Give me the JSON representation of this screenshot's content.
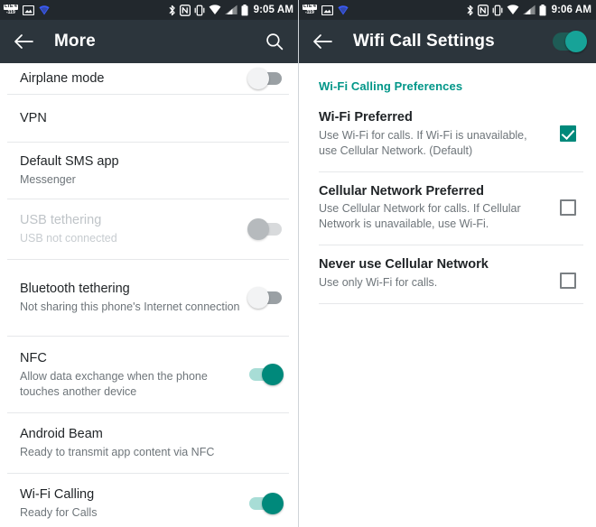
{
  "left": {
    "statusbar": {
      "lte_label": "LTE 4",
      "lte_value": "-119",
      "icons": [
        "image-icon",
        "blue-wifi-triangle-icon"
      ],
      "right_icons": [
        "bluetooth-icon",
        "nfc-icon",
        "vibrate-icon",
        "wifi-icon",
        "signal-icon",
        "battery-icon"
      ],
      "time": "9:05 AM"
    },
    "toolbar": {
      "back_icon": "back-arrow-icon",
      "title": "More",
      "search_icon": "search-icon"
    },
    "rows": [
      {
        "title": "Airplane mode",
        "sub": "",
        "control": "switch",
        "state": "off",
        "disabled": false
      },
      {
        "title": "VPN",
        "sub": "",
        "control": "none",
        "state": "",
        "disabled": false
      },
      {
        "title": "Default SMS app",
        "sub": "Messenger",
        "control": "none",
        "state": "",
        "disabled": false
      },
      {
        "title": "USB tethering",
        "sub": "USB not connected",
        "control": "switch",
        "state": "off",
        "disabled": true
      },
      {
        "title": "Bluetooth tethering",
        "sub": "Not sharing this phone's Internet connection",
        "control": "switch",
        "state": "off",
        "disabled": false
      },
      {
        "title": "NFC",
        "sub": "Allow data exchange when the phone touches another device",
        "control": "switch",
        "state": "on",
        "disabled": false
      },
      {
        "title": "Android Beam",
        "sub": "Ready to transmit app content via NFC",
        "control": "none",
        "state": "",
        "disabled": false
      },
      {
        "title": "Wi-Fi Calling",
        "sub": "Ready for Calls",
        "control": "switch",
        "state": "on",
        "disabled": false
      }
    ]
  },
  "right": {
    "statusbar": {
      "lte_label": "LTE 4",
      "lte_value": "-119",
      "icons": [
        "image-icon",
        "blue-wifi-triangle-icon"
      ],
      "right_icons": [
        "bluetooth-icon",
        "nfc-icon",
        "vibrate-icon",
        "wifi-icon",
        "signal-icon",
        "battery-icon"
      ],
      "time": "9:06 AM"
    },
    "toolbar": {
      "back_icon": "back-arrow-icon",
      "title": "Wifi Call Settings",
      "master_switch": "on"
    },
    "section_header": "Wi-Fi Calling Preferences",
    "options": [
      {
        "title": "Wi-Fi Preferred",
        "sub": "Use Wi-Fi for calls. If Wi-Fi is unavailable, use Cellular Network. (Default)",
        "checked": true
      },
      {
        "title": "Cellular Network Preferred",
        "sub": "Use Cellular Network for calls. If Cellular Network is unavailable, use Wi-Fi.",
        "checked": false
      },
      {
        "title": "Never use Cellular Network",
        "sub": "Use only Wi-Fi for calls.",
        "checked": false
      }
    ]
  },
  "colors": {
    "statusbar_bg": "#22282d",
    "toolbar_bg": "#2c353c",
    "accent_teal": "#00897b",
    "section_header": "#009688",
    "divider": "#e6e8ea"
  }
}
